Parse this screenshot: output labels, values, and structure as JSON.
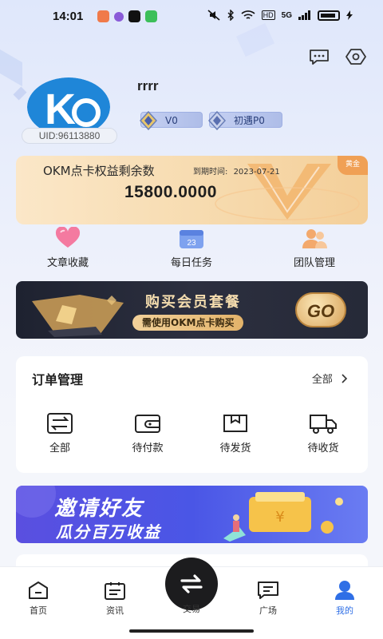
{
  "status_bar": {
    "time": "14:01",
    "network": "5G",
    "hd": "HD"
  },
  "profile": {
    "username": "rrrr",
    "uid": "UID:96113880",
    "level_badge": "V0",
    "rank_badge": "初遇P0"
  },
  "points_card": {
    "title": "OKM点卡权益剩余数",
    "expire_label": "到期时间:",
    "expire_date": "2023-07-21",
    "value": "15800.0000",
    "corner_tag": "黄金"
  },
  "quick_menu": [
    {
      "label": "文章收藏",
      "icon": "heart-icon"
    },
    {
      "label": "每日任务",
      "icon": "calendar-icon",
      "date": "23"
    },
    {
      "label": "团队管理",
      "icon": "team-icon"
    }
  ],
  "vip_banner": {
    "title": "购买会员套餐",
    "subtitle": "需使用OKM点卡购买",
    "go": "GO"
  },
  "orders": {
    "title": "订单管理",
    "all_link": "全部",
    "items": [
      {
        "label": "全部",
        "icon": "list-icon"
      },
      {
        "label": "待付款",
        "icon": "wallet-icon"
      },
      {
        "label": "待发货",
        "icon": "box-icon"
      },
      {
        "label": "待收货",
        "icon": "truck-icon"
      }
    ]
  },
  "invite_banner": {
    "line1": "邀请好友",
    "line2": "瓜分百万收益"
  },
  "tabbar": {
    "items": [
      {
        "label": "首页",
        "icon": "home-icon"
      },
      {
        "label": "资讯",
        "icon": "news-icon"
      },
      {
        "label": "交易",
        "icon": "swap-icon"
      },
      {
        "label": "广场",
        "icon": "chat-icon"
      },
      {
        "label": "我的",
        "icon": "user-icon"
      }
    ],
    "active_index": 4,
    "active_color": "#2f6fe6"
  }
}
